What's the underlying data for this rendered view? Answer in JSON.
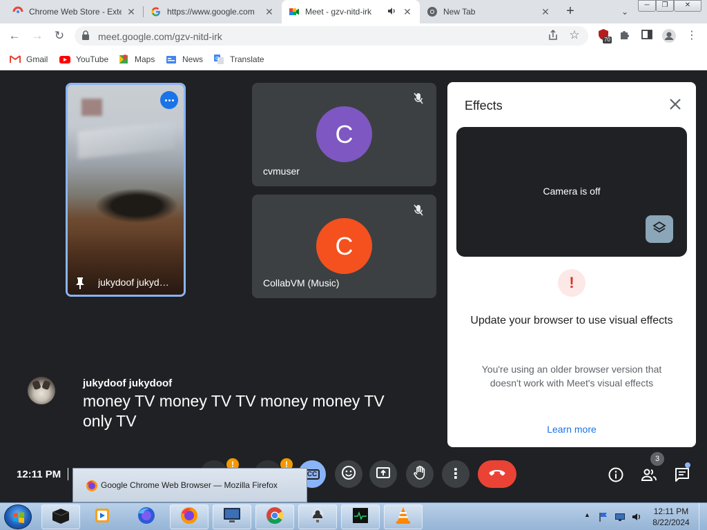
{
  "browser": {
    "tabs": [
      {
        "title": "Chrome Web Store - Exte",
        "active": false
      },
      {
        "title": "https://www.google.com",
        "active": false
      },
      {
        "title": "Meet - gzv-nitd-irk",
        "active": true
      },
      {
        "title": "New Tab",
        "active": false
      }
    ],
    "url": "meet.google.com/gzv-nitd-irk",
    "extension_badge": "70",
    "bookmarks": [
      {
        "label": "Gmail"
      },
      {
        "label": "YouTube"
      },
      {
        "label": "Maps"
      },
      {
        "label": "News"
      },
      {
        "label": "Translate"
      }
    ]
  },
  "meet": {
    "self_tile": {
      "name": "jukydoof jukyd…"
    },
    "participants": [
      {
        "name": "cvmuser",
        "initial": "C",
        "color": "#7e57c2"
      },
      {
        "name": "CollabVM (Music)",
        "initial": "C",
        "color": "#f4511e"
      }
    ],
    "effects": {
      "title": "Effects",
      "camera_status": "Camera is off",
      "warning_icon": "!",
      "heading": "Update your browser to use visual effects",
      "body": "You're using an older browser version that doesn't work with Meet's visual effects",
      "link": "Learn more"
    },
    "caption": {
      "speaker": "jukydoof jukydoof",
      "text": "money TV money TV TV money money TV only TV"
    },
    "controls": {
      "time": "12:11 PM",
      "cc_label": "CC",
      "people_count": "3",
      "hidden_badge_1": "!",
      "hidden_badge_2": "!"
    }
  },
  "taskbar_preview": {
    "title": "Google Chrome Web Browser — Mozilla Firefox"
  },
  "system_tray": {
    "time": "12:11 PM",
    "date": "8/22/2024"
  },
  "colors": {
    "accent_blue": "#1a73e8",
    "hangup_red": "#ea4335",
    "meet_bg": "#202124"
  }
}
